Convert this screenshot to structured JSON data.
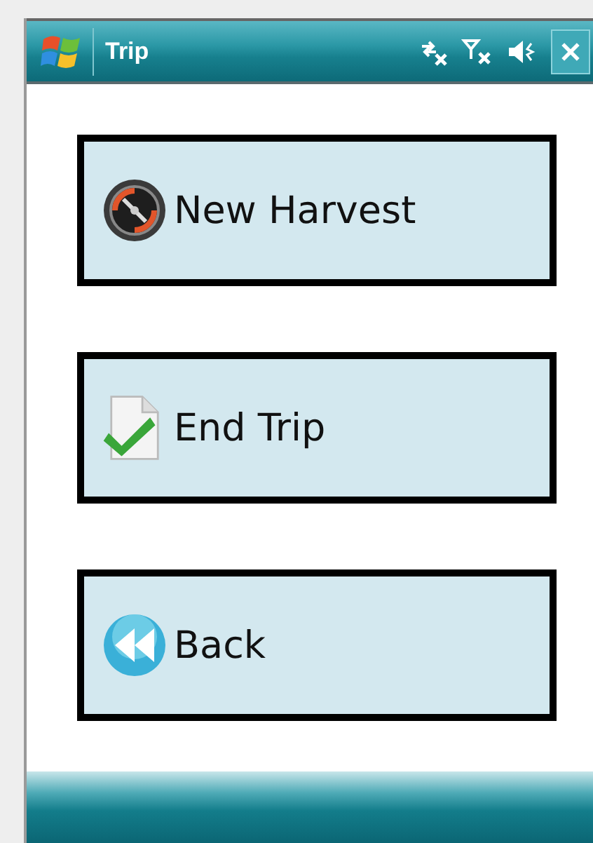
{
  "window": {
    "title": "Trip"
  },
  "buttons": [
    {
      "label": "New Harvest",
      "kind": "compass"
    },
    {
      "label": "End Trip",
      "kind": "check-document"
    },
    {
      "label": "Back",
      "kind": "back"
    }
  ]
}
